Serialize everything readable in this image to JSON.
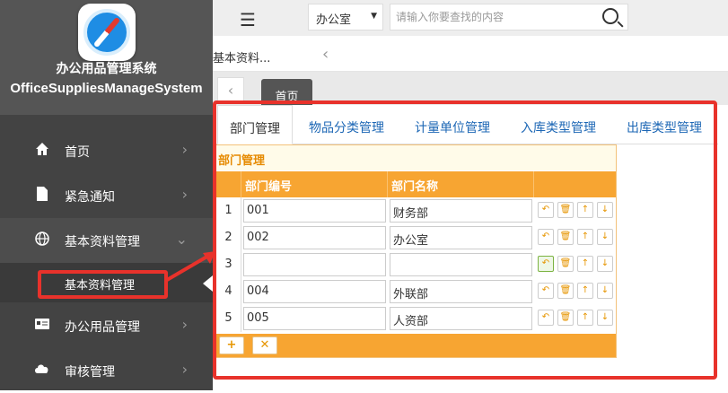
{
  "sidebar": {
    "title_cn": "办公用品管理系统",
    "title_en": "OfficeSuppliesManageSystem",
    "items": [
      {
        "label": "首页"
      },
      {
        "label": "紧急通知"
      },
      {
        "label": "基本资料管理"
      },
      {
        "label": "办公用品管理"
      },
      {
        "label": "审核管理"
      }
    ],
    "sub_item": "基本资料管理"
  },
  "topbar": {
    "category": "办公室",
    "search_placeholder": "请输入你要查找的内容"
  },
  "breadcrumb": "基本资料...",
  "tabs": {
    "home": "首页"
  },
  "subtabs": [
    "部门管理",
    "物品分类管理",
    "计量单位管理",
    "入库类型管理",
    "出库类型管理"
  ],
  "grid": {
    "title": "部门管理",
    "columns": [
      "部门编号",
      "部门名称"
    ],
    "rows": [
      {
        "num": "1",
        "code": "001",
        "name": "财务部"
      },
      {
        "num": "2",
        "code": "002",
        "name": "办公室"
      },
      {
        "num": "3",
        "code": "",
        "name": ""
      },
      {
        "num": "4",
        "code": "004",
        "name": "外联部"
      },
      {
        "num": "5",
        "code": "005",
        "name": "人资部"
      }
    ]
  },
  "colors": {
    "accent": "#f7a532",
    "highlight": "#e8322b",
    "sidebar": "#434343"
  }
}
